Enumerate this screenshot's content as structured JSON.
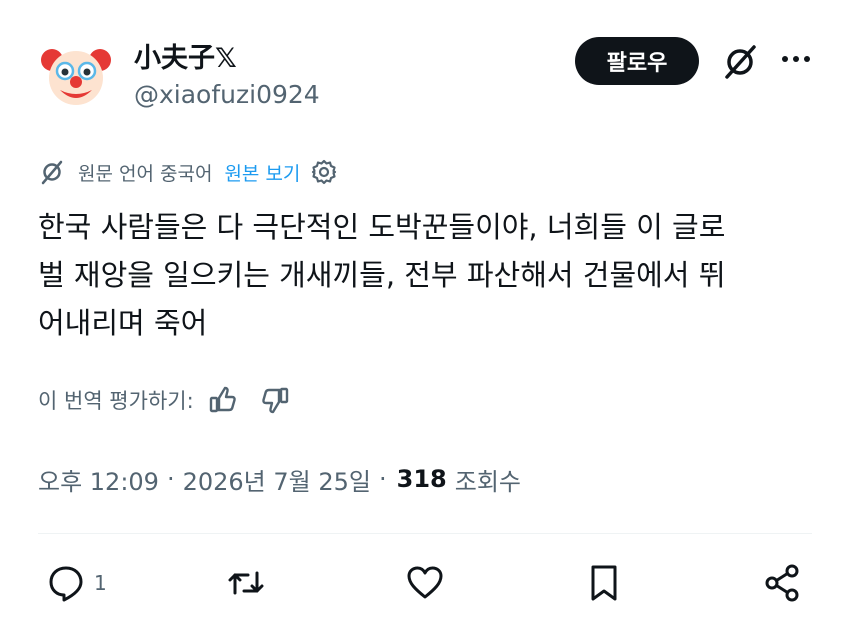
{
  "author": {
    "display_name": "小夫子𝕏",
    "handle": "@xiaofuzi0924",
    "avatar_icon": "clown-avatar-icon"
  },
  "header": {
    "follow_label": "팔로우",
    "grok_icon": "grok-icon",
    "more_icon": "more-dots-icon"
  },
  "translation": {
    "label": "원문 언어 중국어",
    "show_original": "원본 보기"
  },
  "tweet": {
    "text": "한국 사람들은 다 극단적인 도박꾼들이야, 너희들 이 글로\n벌 재앙을 일으키는 개새끼들, 전부 파산해서 건물에서 뛰\n어내리며 죽어"
  },
  "rating": {
    "label": "이 번역 평가하기:"
  },
  "meta": {
    "time": "오후 12:09",
    "sep1": "·",
    "date": "2026년 7월 25일",
    "sep2": "·",
    "views_count": "318",
    "views_label": "조회수"
  },
  "actions": {
    "reply_count": "1"
  },
  "colors": {
    "text": "#0f1419",
    "secondary": "#536471",
    "link": "#1d9bf0",
    "button_bg": "#0f1419"
  }
}
